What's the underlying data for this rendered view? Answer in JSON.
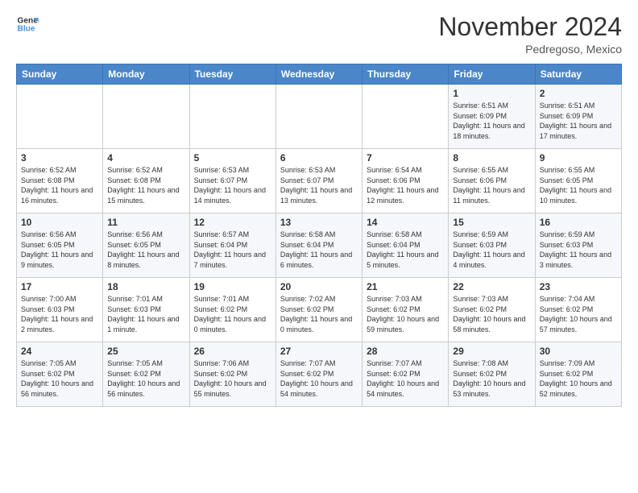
{
  "header": {
    "logo_line1": "General",
    "logo_line2": "Blue",
    "month": "November 2024",
    "location": "Pedregoso, Mexico"
  },
  "weekdays": [
    "Sunday",
    "Monday",
    "Tuesday",
    "Wednesday",
    "Thursday",
    "Friday",
    "Saturday"
  ],
  "weeks": [
    [
      {
        "day": "",
        "content": ""
      },
      {
        "day": "",
        "content": ""
      },
      {
        "day": "",
        "content": ""
      },
      {
        "day": "",
        "content": ""
      },
      {
        "day": "",
        "content": ""
      },
      {
        "day": "1",
        "content": "Sunrise: 6:51 AM\nSunset: 6:09 PM\nDaylight: 11 hours\nand 18 minutes."
      },
      {
        "day": "2",
        "content": "Sunrise: 6:51 AM\nSunset: 6:09 PM\nDaylight: 11 hours\nand 17 minutes."
      }
    ],
    [
      {
        "day": "3",
        "content": "Sunrise: 6:52 AM\nSunset: 6:08 PM\nDaylight: 11 hours\nand 16 minutes."
      },
      {
        "day": "4",
        "content": "Sunrise: 6:52 AM\nSunset: 6:08 PM\nDaylight: 11 hours\nand 15 minutes."
      },
      {
        "day": "5",
        "content": "Sunrise: 6:53 AM\nSunset: 6:07 PM\nDaylight: 11 hours\nand 14 minutes."
      },
      {
        "day": "6",
        "content": "Sunrise: 6:53 AM\nSunset: 6:07 PM\nDaylight: 11 hours\nand 13 minutes."
      },
      {
        "day": "7",
        "content": "Sunrise: 6:54 AM\nSunset: 6:06 PM\nDaylight: 11 hours\nand 12 minutes."
      },
      {
        "day": "8",
        "content": "Sunrise: 6:55 AM\nSunset: 6:06 PM\nDaylight: 11 hours\nand 11 minutes."
      },
      {
        "day": "9",
        "content": "Sunrise: 6:55 AM\nSunset: 6:05 PM\nDaylight: 11 hours\nand 10 minutes."
      }
    ],
    [
      {
        "day": "10",
        "content": "Sunrise: 6:56 AM\nSunset: 6:05 PM\nDaylight: 11 hours\nand 9 minutes."
      },
      {
        "day": "11",
        "content": "Sunrise: 6:56 AM\nSunset: 6:05 PM\nDaylight: 11 hours\nand 8 minutes."
      },
      {
        "day": "12",
        "content": "Sunrise: 6:57 AM\nSunset: 6:04 PM\nDaylight: 11 hours\nand 7 minutes."
      },
      {
        "day": "13",
        "content": "Sunrise: 6:58 AM\nSunset: 6:04 PM\nDaylight: 11 hours\nand 6 minutes."
      },
      {
        "day": "14",
        "content": "Sunrise: 6:58 AM\nSunset: 6:04 PM\nDaylight: 11 hours\nand 5 minutes."
      },
      {
        "day": "15",
        "content": "Sunrise: 6:59 AM\nSunset: 6:03 PM\nDaylight: 11 hours\nand 4 minutes."
      },
      {
        "day": "16",
        "content": "Sunrise: 6:59 AM\nSunset: 6:03 PM\nDaylight: 11 hours\nand 3 minutes."
      }
    ],
    [
      {
        "day": "17",
        "content": "Sunrise: 7:00 AM\nSunset: 6:03 PM\nDaylight: 11 hours\nand 2 minutes."
      },
      {
        "day": "18",
        "content": "Sunrise: 7:01 AM\nSunset: 6:03 PM\nDaylight: 11 hours\nand 1 minute."
      },
      {
        "day": "19",
        "content": "Sunrise: 7:01 AM\nSunset: 6:02 PM\nDaylight: 11 hours\nand 0 minutes."
      },
      {
        "day": "20",
        "content": "Sunrise: 7:02 AM\nSunset: 6:02 PM\nDaylight: 11 hours\nand 0 minutes."
      },
      {
        "day": "21",
        "content": "Sunrise: 7:03 AM\nSunset: 6:02 PM\nDaylight: 10 hours\nand 59 minutes."
      },
      {
        "day": "22",
        "content": "Sunrise: 7:03 AM\nSunset: 6:02 PM\nDaylight: 10 hours\nand 58 minutes."
      },
      {
        "day": "23",
        "content": "Sunrise: 7:04 AM\nSunset: 6:02 PM\nDaylight: 10 hours\nand 57 minutes."
      }
    ],
    [
      {
        "day": "24",
        "content": "Sunrise: 7:05 AM\nSunset: 6:02 PM\nDaylight: 10 hours\nand 56 minutes."
      },
      {
        "day": "25",
        "content": "Sunrise: 7:05 AM\nSunset: 6:02 PM\nDaylight: 10 hours\nand 56 minutes."
      },
      {
        "day": "26",
        "content": "Sunrise: 7:06 AM\nSunset: 6:02 PM\nDaylight: 10 hours\nand 55 minutes."
      },
      {
        "day": "27",
        "content": "Sunrise: 7:07 AM\nSunset: 6:02 PM\nDaylight: 10 hours\nand 54 minutes."
      },
      {
        "day": "28",
        "content": "Sunrise: 7:07 AM\nSunset: 6:02 PM\nDaylight: 10 hours\nand 54 minutes."
      },
      {
        "day": "29",
        "content": "Sunrise: 7:08 AM\nSunset: 6:02 PM\nDaylight: 10 hours\nand 53 minutes."
      },
      {
        "day": "30",
        "content": "Sunrise: 7:09 AM\nSunset: 6:02 PM\nDaylight: 10 hours\nand 52 minutes."
      }
    ]
  ]
}
